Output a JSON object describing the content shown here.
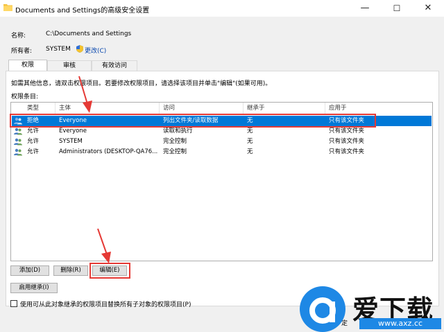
{
  "window": {
    "title": "Documents and Settings的高级安全设置",
    "minimize_glyph": "—",
    "maximize_glyph": "☐",
    "close_glyph": "✕"
  },
  "header": {
    "name_label": "名称:",
    "name_value": "C:\\Documents and Settings",
    "owner_label": "所有者:",
    "owner_value": "SYSTEM",
    "change_link": "更改(C)"
  },
  "tabs": [
    {
      "label": "权限",
      "active": true
    },
    {
      "label": "审核",
      "active": false
    },
    {
      "label": "有效访问",
      "active": false
    }
  ],
  "info_text": "如需其他信息，请双击权限项目。若要修改权限项目，请选择该项目并单击\"编辑\"(如果可用)。",
  "permissions_label": "权限条目:",
  "columns": [
    "类型",
    "主体",
    "访问",
    "继承于",
    "应用于"
  ],
  "rows": [
    {
      "type": "拒绝",
      "principal": "Everyone",
      "access": "列出文件夹/读取数据",
      "inherited": "无",
      "applies": "只有该文件夹",
      "selected": true
    },
    {
      "type": "允许",
      "principal": "Everyone",
      "access": "读取和执行",
      "inherited": "无",
      "applies": "只有该文件夹",
      "selected": false
    },
    {
      "type": "允许",
      "principal": "SYSTEM",
      "access": "完全控制",
      "inherited": "无",
      "applies": "只有该文件夹",
      "selected": false
    },
    {
      "type": "允许",
      "principal": "Administrators (DESKTOP-QA76...",
      "access": "完全控制",
      "inherited": "无",
      "applies": "只有该文件夹",
      "selected": false
    }
  ],
  "buttons": {
    "add": "添加(D)",
    "remove": "删除(R)",
    "edit": "编辑(E)",
    "enable_inheritance": "启用继承(I)"
  },
  "replace_checkbox": {
    "label": "使用可从此对象继承的权限项目替换所有子对象的权限项目(P)",
    "checked": false
  },
  "bottom_partial_text": "定",
  "watermark": {
    "brand": "爱下载",
    "url": "www.axz.cc"
  },
  "colors": {
    "selection": "#0078d7",
    "annotation": "#e53935",
    "brand_blue": "#1e88e5",
    "link": "#0645ad"
  }
}
